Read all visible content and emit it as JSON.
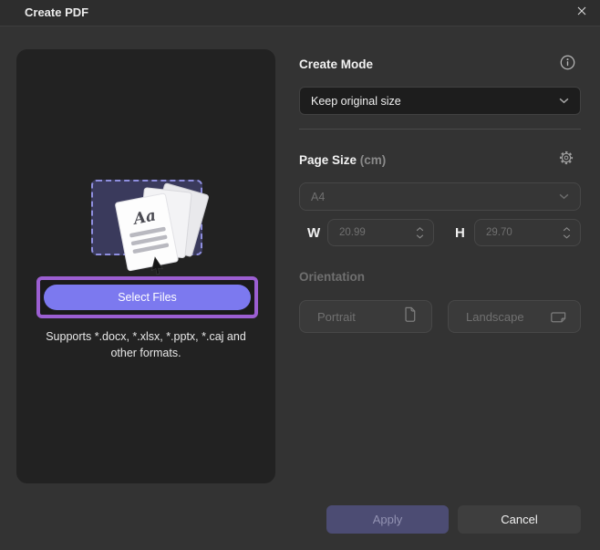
{
  "window": {
    "title": "Create PDF"
  },
  "left_panel": {
    "doc_icon_text": "Aa",
    "select_files_label": "Select Files",
    "supports_text": "Supports *.docx, *.xlsx, *.pptx, *.caj and other formats."
  },
  "create_mode": {
    "label": "Create Mode",
    "selected_option": "Keep original size"
  },
  "page_size": {
    "label": "Page Size",
    "unit_label": "(cm)",
    "preset_value": "A4",
    "width_label": "W",
    "width_value": "20.99",
    "height_label": "H",
    "height_value": "29.70"
  },
  "orientation": {
    "label": "Orientation",
    "portrait_label": "Portrait",
    "landscape_label": "Landscape"
  },
  "footer": {
    "apply_label": "Apply",
    "cancel_label": "Cancel"
  },
  "colors": {
    "accent": "#7c79ef",
    "highlight_border": "#9c5fd2",
    "dialog_bg": "#333333",
    "panel_bg": "#222222",
    "dropzone_bg": "#3a3a5c",
    "dropdown_bg": "#1d1d1d",
    "apply_bg": "#4c4c73",
    "cancel_bg": "#3e3e3e"
  }
}
